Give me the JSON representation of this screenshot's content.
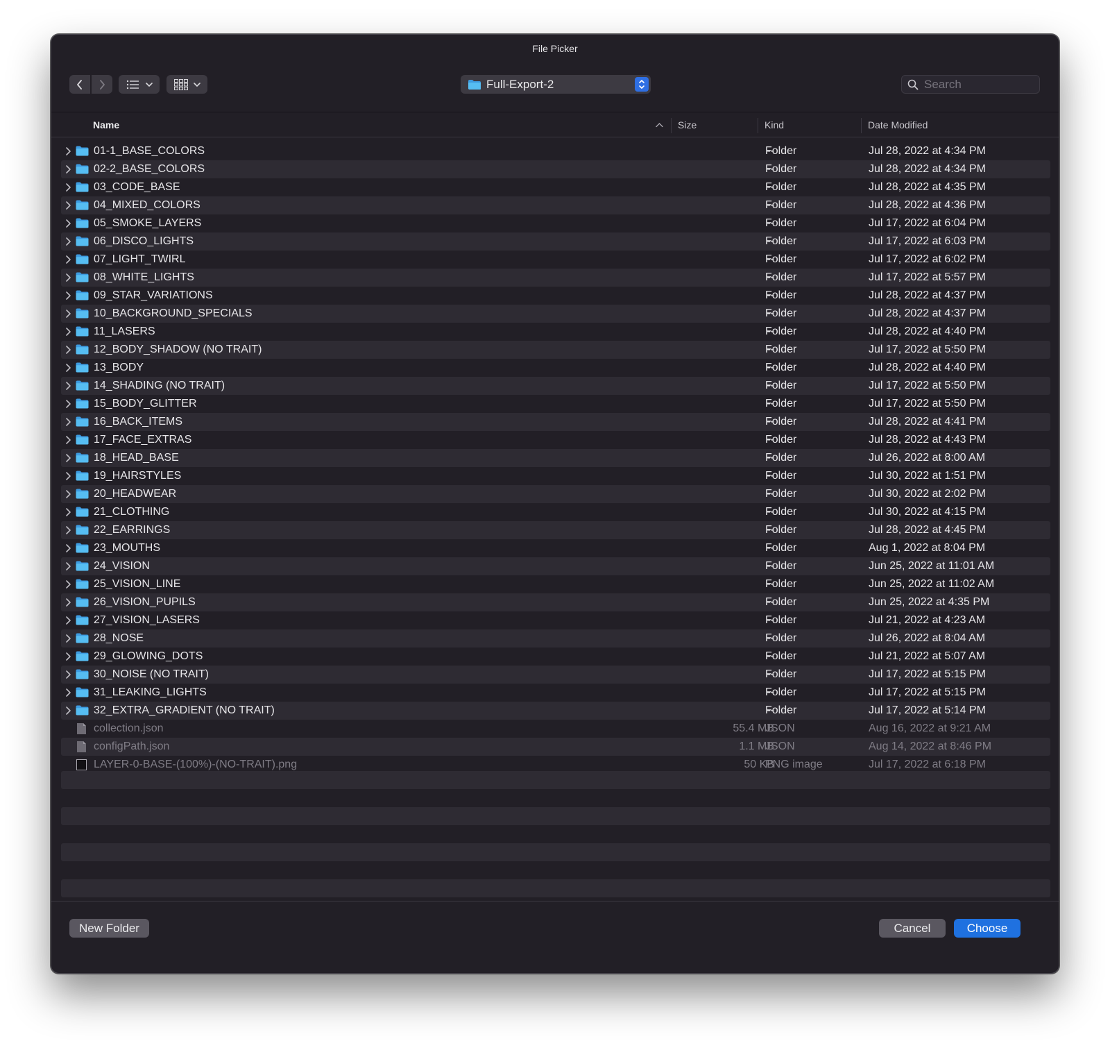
{
  "window": {
    "title": "File Picker"
  },
  "toolbar": {
    "back_icon": "chevron-left-icon",
    "forward_icon": "chevron-right-icon",
    "list_view_icon": "list-icon",
    "grid_view_icon": "grid-icon",
    "current_folder": "Full-Export-2",
    "search_placeholder": "Search"
  },
  "columns": {
    "name": "Name",
    "size": "Size",
    "kind": "Kind",
    "date": "Date Modified"
  },
  "folders": [
    {
      "name": "01-1_BASE_COLORS",
      "size": "--",
      "kind": "Folder",
      "date": "Jul 28, 2022 at 4:34 PM"
    },
    {
      "name": "02-2_BASE_COLORS",
      "size": "--",
      "kind": "Folder",
      "date": "Jul 28, 2022 at 4:34 PM"
    },
    {
      "name": "03_CODE_BASE",
      "size": "--",
      "kind": "Folder",
      "date": "Jul 28, 2022 at 4:35 PM"
    },
    {
      "name": "04_MIXED_COLORS",
      "size": "--",
      "kind": "Folder",
      "date": "Jul 28, 2022 at 4:36 PM"
    },
    {
      "name": "05_SMOKE_LAYERS",
      "size": "--",
      "kind": "Folder",
      "date": "Jul 17, 2022 at 6:04 PM"
    },
    {
      "name": "06_DISCO_LIGHTS",
      "size": "--",
      "kind": "Folder",
      "date": "Jul 17, 2022 at 6:03 PM"
    },
    {
      "name": "07_LIGHT_TWIRL",
      "size": "--",
      "kind": "Folder",
      "date": "Jul 17, 2022 at 6:02 PM"
    },
    {
      "name": "08_WHITE_LIGHTS",
      "size": "--",
      "kind": "Folder",
      "date": "Jul 17, 2022 at 5:57 PM"
    },
    {
      "name": "09_STAR_VARIATIONS",
      "size": "--",
      "kind": "Folder",
      "date": "Jul 28, 2022 at 4:37 PM"
    },
    {
      "name": "10_BACKGROUND_SPECIALS",
      "size": "--",
      "kind": "Folder",
      "date": "Jul 28, 2022 at 4:37 PM"
    },
    {
      "name": "11_LASERS",
      "size": "--",
      "kind": "Folder",
      "date": "Jul 28, 2022 at 4:40 PM"
    },
    {
      "name": "12_BODY_SHADOW (NO TRAIT)",
      "size": "--",
      "kind": "Folder",
      "date": "Jul 17, 2022 at 5:50 PM"
    },
    {
      "name": "13_BODY",
      "size": "--",
      "kind": "Folder",
      "date": "Jul 28, 2022 at 4:40 PM"
    },
    {
      "name": "14_SHADING (NO TRAIT)",
      "size": "--",
      "kind": "Folder",
      "date": "Jul 17, 2022 at 5:50 PM"
    },
    {
      "name": "15_BODY_GLITTER",
      "size": "--",
      "kind": "Folder",
      "date": "Jul 17, 2022 at 5:50 PM"
    },
    {
      "name": "16_BACK_ITEMS",
      "size": "--",
      "kind": "Folder",
      "date": "Jul 28, 2022 at 4:41 PM"
    },
    {
      "name": "17_FACE_EXTRAS",
      "size": "--",
      "kind": "Folder",
      "date": "Jul 28, 2022 at 4:43 PM"
    },
    {
      "name": "18_HEAD_BASE",
      "size": "--",
      "kind": "Folder",
      "date": "Jul 26, 2022 at 8:00 AM"
    },
    {
      "name": "19_HAIRSTYLES",
      "size": "--",
      "kind": "Folder",
      "date": "Jul 30, 2022 at 1:51 PM"
    },
    {
      "name": "20_HEADWEAR",
      "size": "--",
      "kind": "Folder",
      "date": "Jul 30, 2022 at 2:02 PM"
    },
    {
      "name": "21_CLOTHING",
      "size": "--",
      "kind": "Folder",
      "date": "Jul 30, 2022 at 4:15 PM"
    },
    {
      "name": "22_EARRINGS",
      "size": "--",
      "kind": "Folder",
      "date": "Jul 28, 2022 at 4:45 PM"
    },
    {
      "name": "23_MOUTHS",
      "size": "--",
      "kind": "Folder",
      "date": "Aug 1, 2022 at 8:04 PM"
    },
    {
      "name": "24_VISION",
      "size": "--",
      "kind": "Folder",
      "date": "Jun 25, 2022 at 11:01 AM"
    },
    {
      "name": "25_VISION_LINE",
      "size": "--",
      "kind": "Folder",
      "date": "Jun 25, 2022 at 11:02 AM"
    },
    {
      "name": "26_VISION_PUPILS",
      "size": "--",
      "kind": "Folder",
      "date": "Jun 25, 2022 at 4:35 PM"
    },
    {
      "name": "27_VISION_LASERS",
      "size": "--",
      "kind": "Folder",
      "date": "Jul 21, 2022 at 4:23 AM"
    },
    {
      "name": "28_NOSE",
      "size": "--",
      "kind": "Folder",
      "date": "Jul 26, 2022 at 8:04 AM"
    },
    {
      "name": "29_GLOWING_DOTS",
      "size": "--",
      "kind": "Folder",
      "date": "Jul 21, 2022 at 5:07 AM"
    },
    {
      "name": "30_NOISE (NO TRAIT)",
      "size": "--",
      "kind": "Folder",
      "date": "Jul 17, 2022 at 5:15 PM"
    },
    {
      "name": "31_LEAKING_LIGHTS",
      "size": "--",
      "kind": "Folder",
      "date": "Jul 17, 2022 at 5:15 PM"
    },
    {
      "name": "32_EXTRA_GRADIENT (NO TRAIT)",
      "size": "--",
      "kind": "Folder",
      "date": "Jul 17, 2022 at 5:14 PM"
    }
  ],
  "files": [
    {
      "name": "collection.json",
      "size": "55.4 MB",
      "kind": "JSON",
      "date": "Aug 16, 2022 at 9:21 AM",
      "icon": "document-icon"
    },
    {
      "name": "configPath.json",
      "size": "1.1 MB",
      "kind": "JSON",
      "date": "Aug 14, 2022 at 8:46 PM",
      "icon": "document-icon"
    },
    {
      "name": "LAYER-0-BASE-(100%)-(NO-TRAIT).png",
      "size": "50 KB",
      "kind": "PNG image",
      "date": "Jul 17, 2022 at 6:18 PM",
      "icon": "image-thumbnail-icon"
    }
  ],
  "footer": {
    "new_folder": "New Folder",
    "cancel": "Cancel",
    "choose": "Choose"
  },
  "colors": {
    "accent": "#1f71e0",
    "folder": "#4fb3ee",
    "window_bg": "#221f26",
    "row_alt": "#2e2b33"
  }
}
